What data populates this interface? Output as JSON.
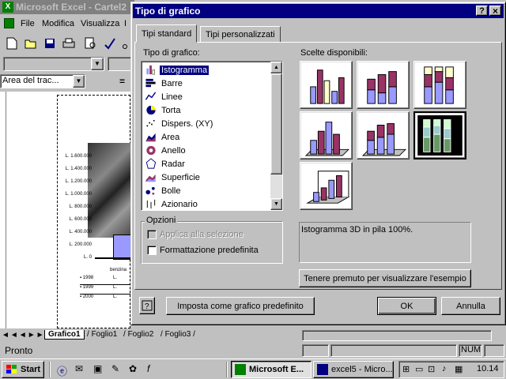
{
  "excel": {
    "title": "Microsoft Excel - Cartel2",
    "menu": [
      "File",
      "Modifica",
      "Visualizza",
      "I"
    ],
    "name_box": "Area del trac...",
    "chart_y_labels": [
      "L. 1.600.000",
      "L. 1.400.000",
      "L. 1.200.000",
      "L. 1.000.000",
      "L. 800.000",
      "L. 600.000",
      "L. 400.000",
      "L. 200.000",
      "L. 0"
    ],
    "chart_x_label": "benzina",
    "legend_rows": [
      {
        "year": "1998",
        "value": "L."
      },
      {
        "year": "1999",
        "value": "L."
      },
      {
        "year": "2000",
        "value": "L."
      }
    ],
    "sheet_tabs": [
      "Grafico1",
      "Foglio1",
      "Foglio2",
      "Foglio3"
    ],
    "status_text": "Pronto",
    "status_num": "NUM"
  },
  "dialog": {
    "title": "Tipo di grafico",
    "title_buttons": [
      "?",
      "×"
    ],
    "tabs": [
      "Tipi standard",
      "Tipi personalizzati"
    ],
    "chart_type_label": "Tipo di grafico:",
    "chart_types": [
      "Istogramma",
      "Barre",
      "Linee",
      "Torta",
      "Dispers. (XY)",
      "Area",
      "Anello",
      "Radar",
      "Superficie",
      "Bolle",
      "Azionario"
    ],
    "subtypes_label": "Scelte disponibili:",
    "options_label": "Opzioni",
    "option_apply": "Applica alla selezione",
    "option_default_format": "Formattazione predefinita",
    "description": "Istogramma 3D in pila 100%.",
    "preview_button": "Tenere premuto per visualizzare l'esempio",
    "set_default_button": "Imposta come grafico predefinito",
    "ok_button": "OK",
    "cancel_button": "Annulla"
  },
  "taskbar": {
    "start": "Start",
    "tasks": [
      "Microsoft E...",
      "excel5 - Micro..."
    ],
    "clock": "10.14"
  },
  "colors": {
    "titlebar": "#000080",
    "face": "#c0c0c0",
    "selection": "#000080",
    "bar_blue": "#9999ff",
    "bar_maroon": "#993366",
    "bar_yellow": "#ffffcc"
  }
}
